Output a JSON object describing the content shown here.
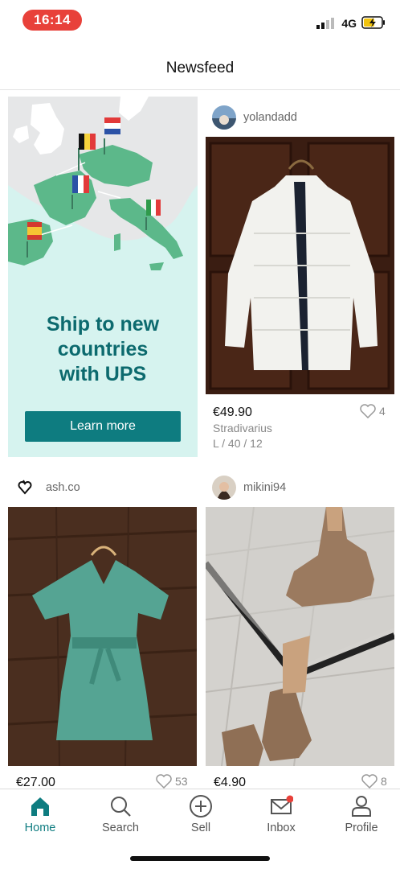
{
  "status_bar": {
    "time": "16:14",
    "network": "4G"
  },
  "header": {
    "title": "Newsfeed"
  },
  "promo": {
    "line1": "Ship to new",
    "line2": "countries",
    "line3": "with UPS",
    "button_label": "Learn more"
  },
  "items": [
    {
      "username": "yolandadd",
      "price": "€49.90",
      "favorites": "4",
      "brand": "Stradivarius",
      "size": "L / 40 / 12"
    },
    {
      "username": "ash.co",
      "price": "€27.00",
      "favorites": "53"
    },
    {
      "username": "mikini94",
      "price": "€4.90",
      "favorites": "8"
    }
  ],
  "tabbar": {
    "tabs": [
      {
        "label": "Home",
        "icon": "home-icon",
        "active": true
      },
      {
        "label": "Search",
        "icon": "search-icon"
      },
      {
        "label": "Sell",
        "icon": "plus-circle-icon"
      },
      {
        "label": "Inbox",
        "icon": "mail-icon"
      },
      {
        "label": "Profile",
        "icon": "person-icon"
      }
    ]
  },
  "colors": {
    "accent": "#0e7c80",
    "time_pill": "#e8413a",
    "promo_bg": "#d6f3ef",
    "notification_dot": "#e8413a"
  }
}
